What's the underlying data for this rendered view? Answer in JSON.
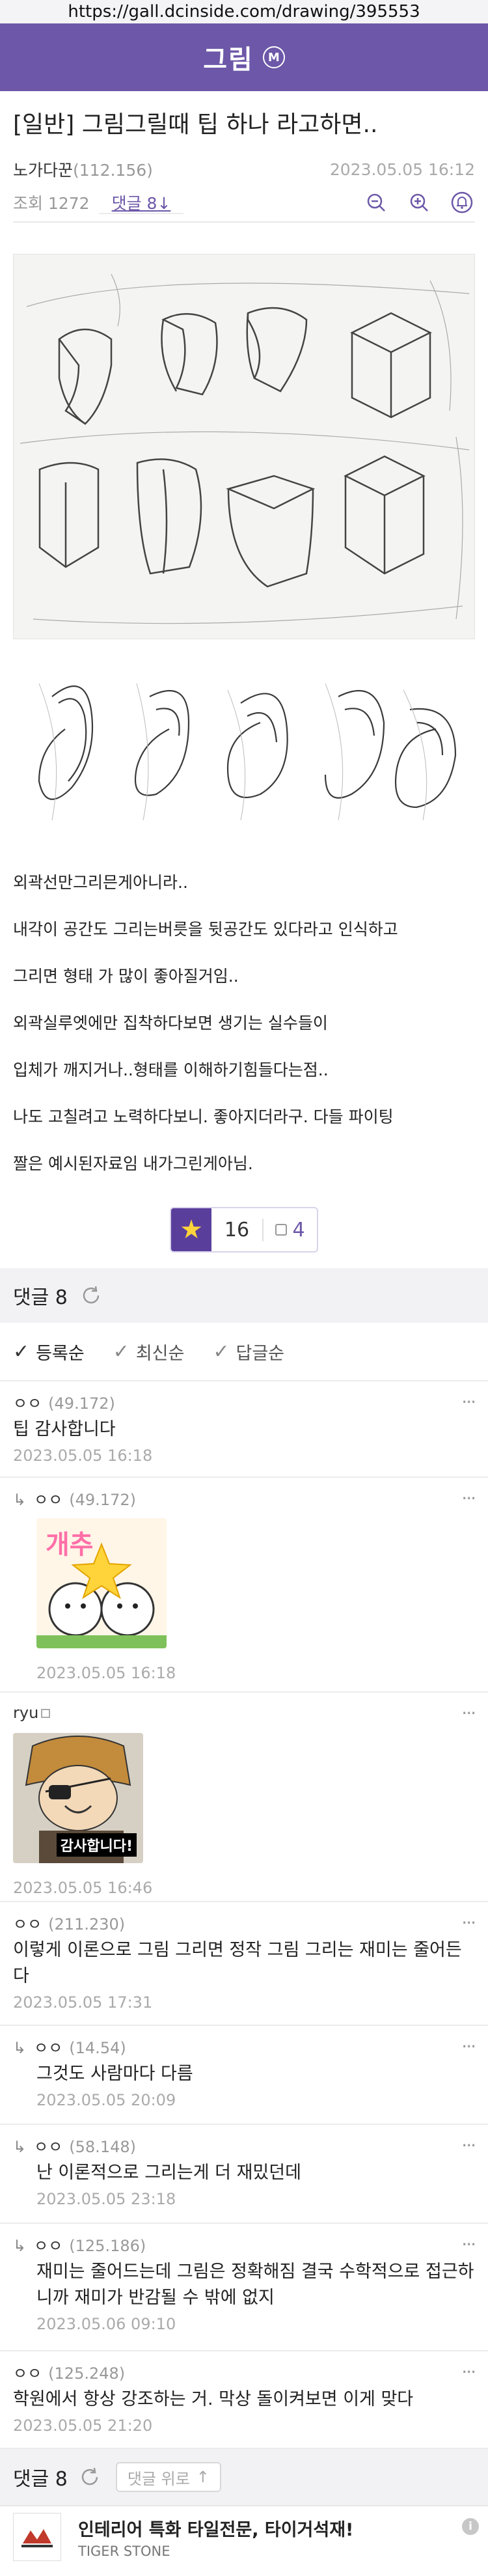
{
  "browser": {
    "url": "https://gall.dcinside.com/drawing/395553"
  },
  "gallery": {
    "title": "그림",
    "badge": "M"
  },
  "post": {
    "title": "[일반] 그림그릴때 팁 하나 라고하면..",
    "author": "노가다꾼",
    "author_ip": "(112.156)",
    "date": "2023.05.05 16:12",
    "views": "조회 1272",
    "comments_link": "댓글 8",
    "body": [
      "외곽선만그리믄게아니라..",
      "내각이 공간도 그리는버릇을 뒷공간도 있다라고 인식하고",
      "그리면 형태 가 많이 좋아질거임..",
      "외곽실루엣에만 집착하다보면 생기는 실수들이",
      "입체가 깨지거나..형태를 이해하기힘들다는점..",
      "나도 고칠려고 노력하다보니. 좋아지더라구. 다들 파이팅",
      "짤은 예시된자료임 내가그린게아님."
    ],
    "recommend_count": "16",
    "downvote_count": "4"
  },
  "comments_section": {
    "header_label": "댓글 8",
    "sort": [
      "등록순",
      "최신순",
      "답글순"
    ],
    "footer_label": "댓글 8",
    "to_top_label": "댓글 위로"
  },
  "comments": [
    {
      "author": "ㅇㅇ",
      "ip": "(49.172)",
      "text": "팁 감사합니다",
      "date": "2023.05.05 16:18"
    },
    {
      "author": "ㅇㅇ",
      "ip": "(49.172)",
      "dccon_text": "개추",
      "date": "2023.05.05 16:18"
    },
    {
      "author": "ryu",
      "dccon_text": "감사합니다!",
      "date": "2023.05.05 16:46"
    },
    {
      "author": "ㅇㅇ",
      "ip": "(211.230)",
      "text": "이렇게 이론으로 그림 그리면 정작 그림 그리는 재미는 줄어든다",
      "date": "2023.05.05 17:31"
    },
    {
      "author": "ㅇㅇ",
      "ip": "(14.54)",
      "text": "그것도 사람마다 다름",
      "date": "2023.05.05 20:09"
    },
    {
      "author": "ㅇㅇ",
      "ip": "(58.148)",
      "text": "난 이론적으로 그리는게 더 재밌던데",
      "date": "2023.05.05 23:18"
    },
    {
      "author": "ㅇㅇ",
      "ip": "(125.186)",
      "text": "재미는 줄어드는데 그림은 정확해짐 결국 수학적으로 접근하니까 재미가 반감될 수 밖에 없지",
      "date": "2023.05.06 09:10"
    },
    {
      "author": "ㅇㅇ",
      "ip": "(125.248)",
      "text": "학원에서 항상 강조하는 거. 막상 돌이켜보면 이게 맞다",
      "date": "2023.05.05 21:20"
    }
  ],
  "ad": {
    "title": "인테리어 특화 타일전문, 타이거석재!",
    "sub": "TIGER STONE",
    "info": "i"
  },
  "colors": {
    "brand": "#6c57a8",
    "star": "#ffd43b"
  },
  "icons": [
    "zoom-out-icon",
    "zoom-in-icon",
    "bell-icon",
    "refresh-icon",
    "checkmark-icon",
    "reply-arrow-icon",
    "more-icon",
    "star-icon",
    "info-icon"
  ]
}
